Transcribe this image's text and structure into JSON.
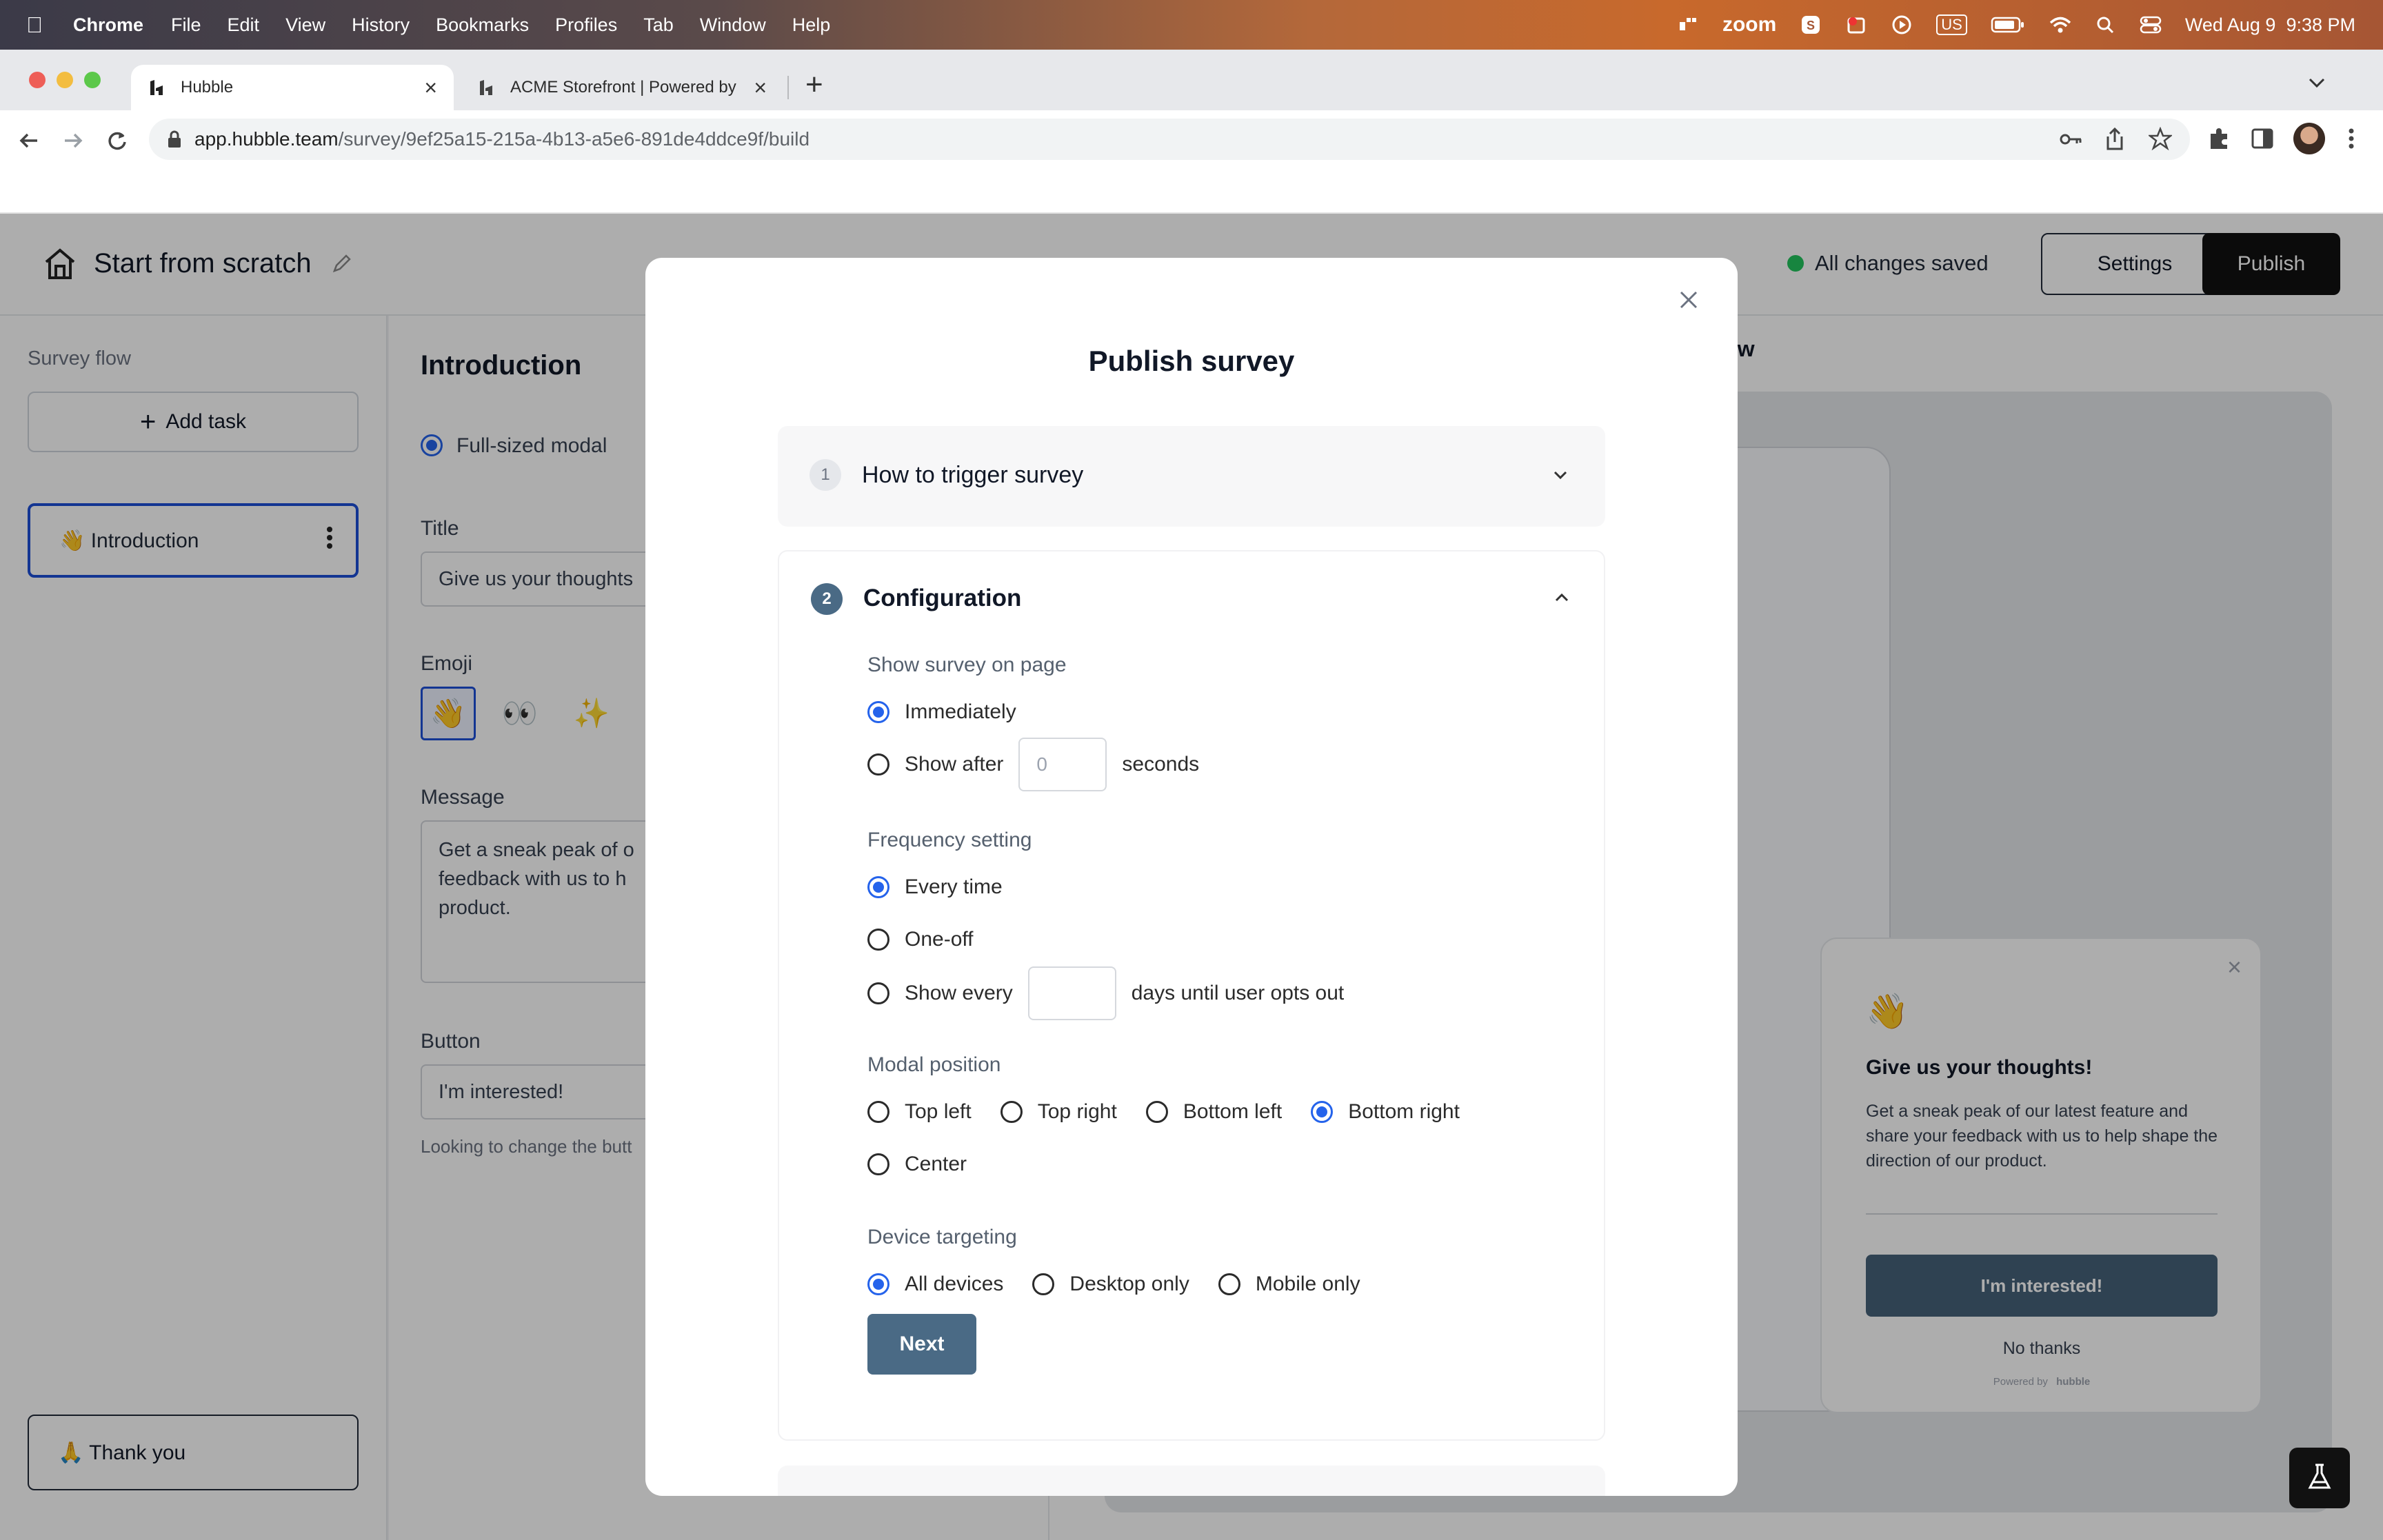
{
  "menubar": {
    "app": "Chrome",
    "items": [
      "File",
      "Edit",
      "View",
      "History",
      "Bookmarks",
      "Profiles",
      "Tab",
      "Window",
      "Help"
    ],
    "status_zoom": "zoom",
    "status_input": "US",
    "clock": "Wed Aug 9  9:38 PM"
  },
  "browser": {
    "tabs": [
      {
        "title": "Hubble"
      },
      {
        "title": "ACME Storefront | Powered by"
      }
    ],
    "url_host": "app.hubble.team",
    "url_path": "/survey/9ef25a15-215a-4b13-a5e6-891de4ddce9f/build"
  },
  "header": {
    "title": "Start from scratch",
    "save_status": "All changes saved",
    "settings_label": "Settings",
    "publish_label": "Publish"
  },
  "sidebar": {
    "heading": "Survey flow",
    "add_task_label": "Add task",
    "items": [
      {
        "label": "👋 Introduction"
      },
      {
        "label": "🙏 Thank you"
      }
    ]
  },
  "editor": {
    "heading": "Introduction",
    "layout_option": "Full-sized modal",
    "title_label": "Title",
    "title_value": "Give us your thoughts",
    "emoji_label": "Emoji",
    "emojis": [
      "👋",
      "👀",
      "✨"
    ],
    "message_label": "Message",
    "message_lines": [
      "Get a sneak peak of o",
      "feedback with us to h",
      "product."
    ],
    "button_label": "Button",
    "button_value": "I'm interested!",
    "hint": "Looking to change the butt"
  },
  "preview": {
    "header_fragment": "ew",
    "emoji": "👋",
    "card_title": "Give us your thoughts!",
    "card_body": "Get a sneak peak of our latest feature and share your feedback with us to help shape the direction of our product.",
    "primary": "I'm interested!",
    "secondary": "No thanks",
    "powered": "Powered by",
    "brand": "hubble"
  },
  "modal": {
    "title": "Publish survey",
    "step1": {
      "num": "1",
      "title": "How to trigger survey"
    },
    "step2": {
      "num": "2",
      "title": "Configuration"
    },
    "show_on_page": {
      "label": "Show survey on page",
      "immediately": "Immediately",
      "show_after": "Show after",
      "seconds_placeholder": "0",
      "seconds": "seconds"
    },
    "frequency": {
      "label": "Frequency setting",
      "every_time": "Every time",
      "one_off": "One-off",
      "show_every": "Show every",
      "days_value": "",
      "days_suffix": "days until user opts out"
    },
    "position": {
      "label": "Modal position",
      "top_left": "Top left",
      "top_right": "Top right",
      "bottom_left": "Bottom left",
      "bottom_right": "Bottom right",
      "center": "Center"
    },
    "device": {
      "label": "Device targeting",
      "all": "All devices",
      "desktop": "Desktop only",
      "mobile": "Mobile only"
    },
    "next_label": "Next"
  },
  "colors": {
    "accent": "#2563eb",
    "next_button": "#4a6a85",
    "preview_primary": "#46627a",
    "saved_dot": "#22c55e"
  }
}
